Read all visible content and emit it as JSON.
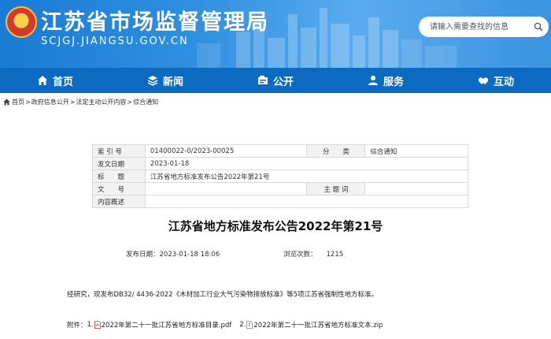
{
  "header": {
    "site_title": "江苏省市场监督管理局",
    "site_domain": "SCJGJ.JIANGSU.GOV.CN",
    "search_placeholder": "请输入需要查找的信息",
    "colors": {
      "header_blue": "#1a7bd4",
      "nav_blue": "#0c6ac0"
    }
  },
  "nav": {
    "items": [
      {
        "label": "首页",
        "icon": "home-icon"
      },
      {
        "label": "新闻",
        "icon": "layers-icon"
      },
      {
        "label": "公开",
        "icon": "open-icon"
      },
      {
        "label": "服务",
        "icon": "user-icon"
      },
      {
        "label": "互动",
        "icon": "handshake-icon"
      }
    ]
  },
  "breadcrumb": {
    "items": [
      "首页",
      "政府信息公开",
      "法定主动公开内容",
      "综合通知"
    ],
    "separator": ">"
  },
  "meta": {
    "index_label": "索 引 号",
    "index_value": "01400022-0/2023-00025",
    "category_label": "分　　类",
    "category_value": "综合通知",
    "date_label": "发文日期",
    "date_value": "2023-01-18",
    "title_label": "标　　题",
    "title_value": "江苏省地方标准发布公告2022年第21号",
    "docno_label": "文　　号",
    "docno_value": "",
    "subject_label": "主 题 词",
    "subject_value": "",
    "summary_label": "内容概述",
    "summary_value": ""
  },
  "article": {
    "title": "江苏省地方标准发布公告2022年第21号",
    "publish_time_label": "发布日期：",
    "publish_time": "2023-01-18 18:06",
    "views_label": "浏览次数：",
    "views": "1215",
    "body": "经研究，现发布DB32/  4436-2022《木材加工行业大气污染物排放标准》等5项江苏省强制性地方标准。",
    "attachments_label": "附件：",
    "attachments": [
      {
        "index": "1.",
        "name": "2022年第二十一批江苏省地方标准目录.pdf",
        "icon": "pdf-file-icon"
      },
      {
        "index": "2.",
        "name": "2022年第二十一批江苏省地方标准文本.zip",
        "icon": "zip-file-icon"
      }
    ]
  }
}
